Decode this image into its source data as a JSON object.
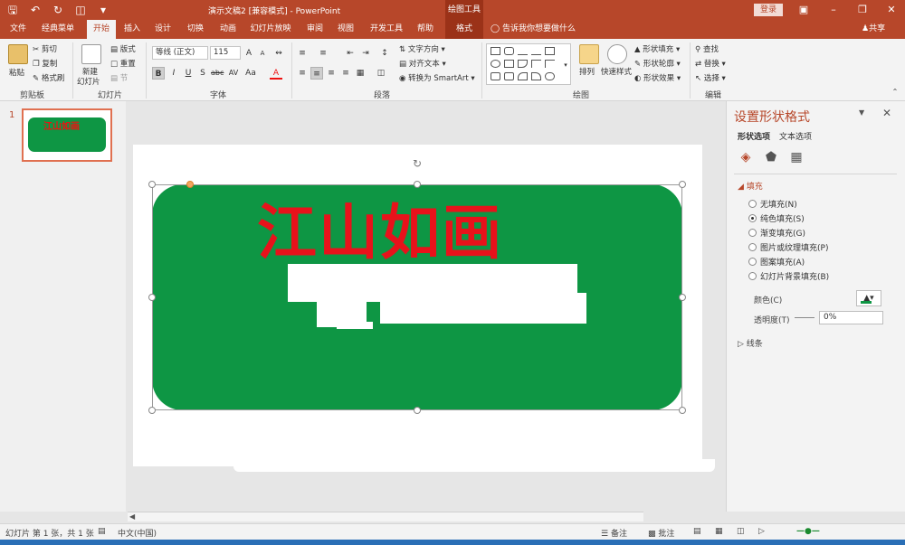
{
  "window": {
    "title": "演示文稿2 [兼容模式] - PowerPoint",
    "context_tools": "绘图工具",
    "login": "登录"
  },
  "tabs": [
    "文件",
    "经典菜单",
    "开始",
    "插入",
    "设计",
    "切换",
    "动画",
    "幻灯片放映",
    "审阅",
    "视图",
    "开发工具",
    "帮助",
    "格式"
  ],
  "tell_me": "告诉我你想要做什么",
  "share": "共享",
  "ribbon": {
    "clipboard": {
      "label": "剪贴板",
      "paste": "粘贴",
      "cut": "剪切",
      "copy": "复制",
      "format_painter": "格式刷"
    },
    "slides": {
      "label": "幻灯片",
      "new_slide": "新建",
      "new_slide2": "幻灯片",
      "layout": "版式",
      "reset": "重置",
      "section": "节"
    },
    "font": {
      "label": "字体",
      "font_name": "等线 (正文)",
      "font_size": "115"
    },
    "paragraph": {
      "label": "段落",
      "text_direction": "文字方向",
      "align_text": "对齐文本",
      "smartart": "转换为 SmartArt"
    },
    "drawing": {
      "label": "绘图",
      "arrange": "排列",
      "quick_styles": "快速样式",
      "shape_fill": "形状填充",
      "shape_outline": "形状轮廓",
      "shape_effects": "形状效果"
    },
    "editing": {
      "label": "编辑",
      "find": "查找",
      "replace": "替换",
      "select": "选择"
    }
  },
  "slide": {
    "number": "1",
    "wordart": "江山如画",
    "shape_color": "#0e9644",
    "text_color": "#e8121b"
  },
  "format_pane": {
    "title": "设置形状格式",
    "subtabs": [
      "形状选项",
      "文本选项"
    ],
    "fill_section": "填充",
    "fill_options": [
      {
        "label": "无填充(N)",
        "checked": false
      },
      {
        "label": "纯色填充(S)",
        "checked": true
      },
      {
        "label": "渐变填充(G)",
        "checked": false
      },
      {
        "label": "图片或纹理填充(P)",
        "checked": false
      },
      {
        "label": "图案填充(A)",
        "checked": false
      },
      {
        "label": "幻灯片背景填充(B)",
        "checked": false
      }
    ],
    "color_label": "颜色(C)",
    "transparency_label": "透明度(T)",
    "transparency_value": "0%",
    "line_section": "线条"
  },
  "status": {
    "slide_info": "幻灯片 第 1 张，共 1 张",
    "language": "中文(中国)",
    "notes": "备注",
    "comments": "批注"
  }
}
